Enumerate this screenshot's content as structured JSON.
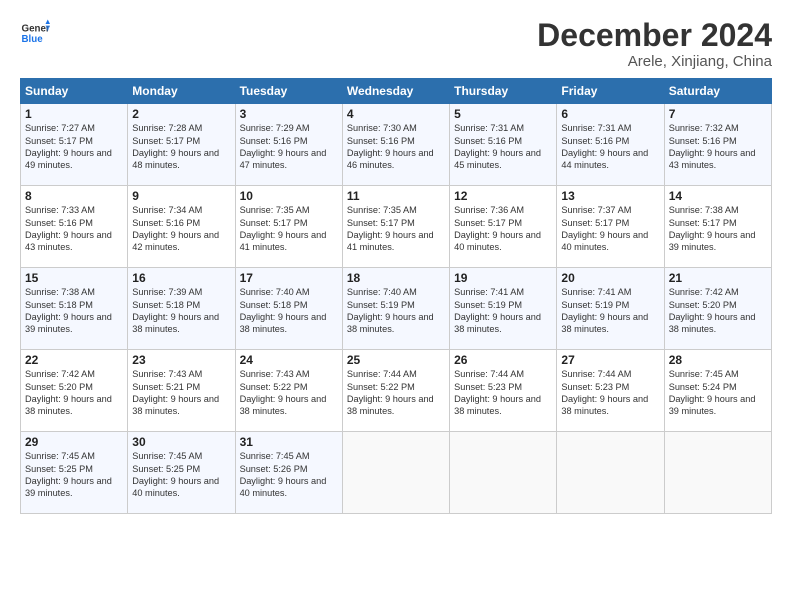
{
  "logo": {
    "line1": "General",
    "line2": "Blue"
  },
  "title": "December 2024",
  "subtitle": "Arele, Xinjiang, China",
  "days_header": [
    "Sunday",
    "Monday",
    "Tuesday",
    "Wednesday",
    "Thursday",
    "Friday",
    "Saturday"
  ],
  "weeks": [
    [
      {
        "day": 1,
        "sunrise": "7:27 AM",
        "sunset": "5:17 PM",
        "daylight": "9 hours and 49 minutes."
      },
      {
        "day": 2,
        "sunrise": "7:28 AM",
        "sunset": "5:17 PM",
        "daylight": "9 hours and 48 minutes."
      },
      {
        "day": 3,
        "sunrise": "7:29 AM",
        "sunset": "5:16 PM",
        "daylight": "9 hours and 47 minutes."
      },
      {
        "day": 4,
        "sunrise": "7:30 AM",
        "sunset": "5:16 PM",
        "daylight": "9 hours and 46 minutes."
      },
      {
        "day": 5,
        "sunrise": "7:31 AM",
        "sunset": "5:16 PM",
        "daylight": "9 hours and 45 minutes."
      },
      {
        "day": 6,
        "sunrise": "7:31 AM",
        "sunset": "5:16 PM",
        "daylight": "9 hours and 44 minutes."
      },
      {
        "day": 7,
        "sunrise": "7:32 AM",
        "sunset": "5:16 PM",
        "daylight": "9 hours and 43 minutes."
      }
    ],
    [
      {
        "day": 8,
        "sunrise": "7:33 AM",
        "sunset": "5:16 PM",
        "daylight": "9 hours and 43 minutes."
      },
      {
        "day": 9,
        "sunrise": "7:34 AM",
        "sunset": "5:16 PM",
        "daylight": "9 hours and 42 minutes."
      },
      {
        "day": 10,
        "sunrise": "7:35 AM",
        "sunset": "5:17 PM",
        "daylight": "9 hours and 41 minutes."
      },
      {
        "day": 11,
        "sunrise": "7:35 AM",
        "sunset": "5:17 PM",
        "daylight": "9 hours and 41 minutes."
      },
      {
        "day": 12,
        "sunrise": "7:36 AM",
        "sunset": "5:17 PM",
        "daylight": "9 hours and 40 minutes."
      },
      {
        "day": 13,
        "sunrise": "7:37 AM",
        "sunset": "5:17 PM",
        "daylight": "9 hours and 40 minutes."
      },
      {
        "day": 14,
        "sunrise": "7:38 AM",
        "sunset": "5:17 PM",
        "daylight": "9 hours and 39 minutes."
      }
    ],
    [
      {
        "day": 15,
        "sunrise": "7:38 AM",
        "sunset": "5:18 PM",
        "daylight": "9 hours and 39 minutes."
      },
      {
        "day": 16,
        "sunrise": "7:39 AM",
        "sunset": "5:18 PM",
        "daylight": "9 hours and 38 minutes."
      },
      {
        "day": 17,
        "sunrise": "7:40 AM",
        "sunset": "5:18 PM",
        "daylight": "9 hours and 38 minutes."
      },
      {
        "day": 18,
        "sunrise": "7:40 AM",
        "sunset": "5:19 PM",
        "daylight": "9 hours and 38 minutes."
      },
      {
        "day": 19,
        "sunrise": "7:41 AM",
        "sunset": "5:19 PM",
        "daylight": "9 hours and 38 minutes."
      },
      {
        "day": 20,
        "sunrise": "7:41 AM",
        "sunset": "5:19 PM",
        "daylight": "9 hours and 38 minutes."
      },
      {
        "day": 21,
        "sunrise": "7:42 AM",
        "sunset": "5:20 PM",
        "daylight": "9 hours and 38 minutes."
      }
    ],
    [
      {
        "day": 22,
        "sunrise": "7:42 AM",
        "sunset": "5:20 PM",
        "daylight": "9 hours and 38 minutes."
      },
      {
        "day": 23,
        "sunrise": "7:43 AM",
        "sunset": "5:21 PM",
        "daylight": "9 hours and 38 minutes."
      },
      {
        "day": 24,
        "sunrise": "7:43 AM",
        "sunset": "5:22 PM",
        "daylight": "9 hours and 38 minutes."
      },
      {
        "day": 25,
        "sunrise": "7:44 AM",
        "sunset": "5:22 PM",
        "daylight": "9 hours and 38 minutes."
      },
      {
        "day": 26,
        "sunrise": "7:44 AM",
        "sunset": "5:23 PM",
        "daylight": "9 hours and 38 minutes."
      },
      {
        "day": 27,
        "sunrise": "7:44 AM",
        "sunset": "5:23 PM",
        "daylight": "9 hours and 38 minutes."
      },
      {
        "day": 28,
        "sunrise": "7:45 AM",
        "sunset": "5:24 PM",
        "daylight": "9 hours and 39 minutes."
      }
    ],
    [
      {
        "day": 29,
        "sunrise": "7:45 AM",
        "sunset": "5:25 PM",
        "daylight": "9 hours and 39 minutes."
      },
      {
        "day": 30,
        "sunrise": "7:45 AM",
        "sunset": "5:25 PM",
        "daylight": "9 hours and 40 minutes."
      },
      {
        "day": 31,
        "sunrise": "7:45 AM",
        "sunset": "5:26 PM",
        "daylight": "9 hours and 40 minutes."
      },
      null,
      null,
      null,
      null
    ]
  ]
}
